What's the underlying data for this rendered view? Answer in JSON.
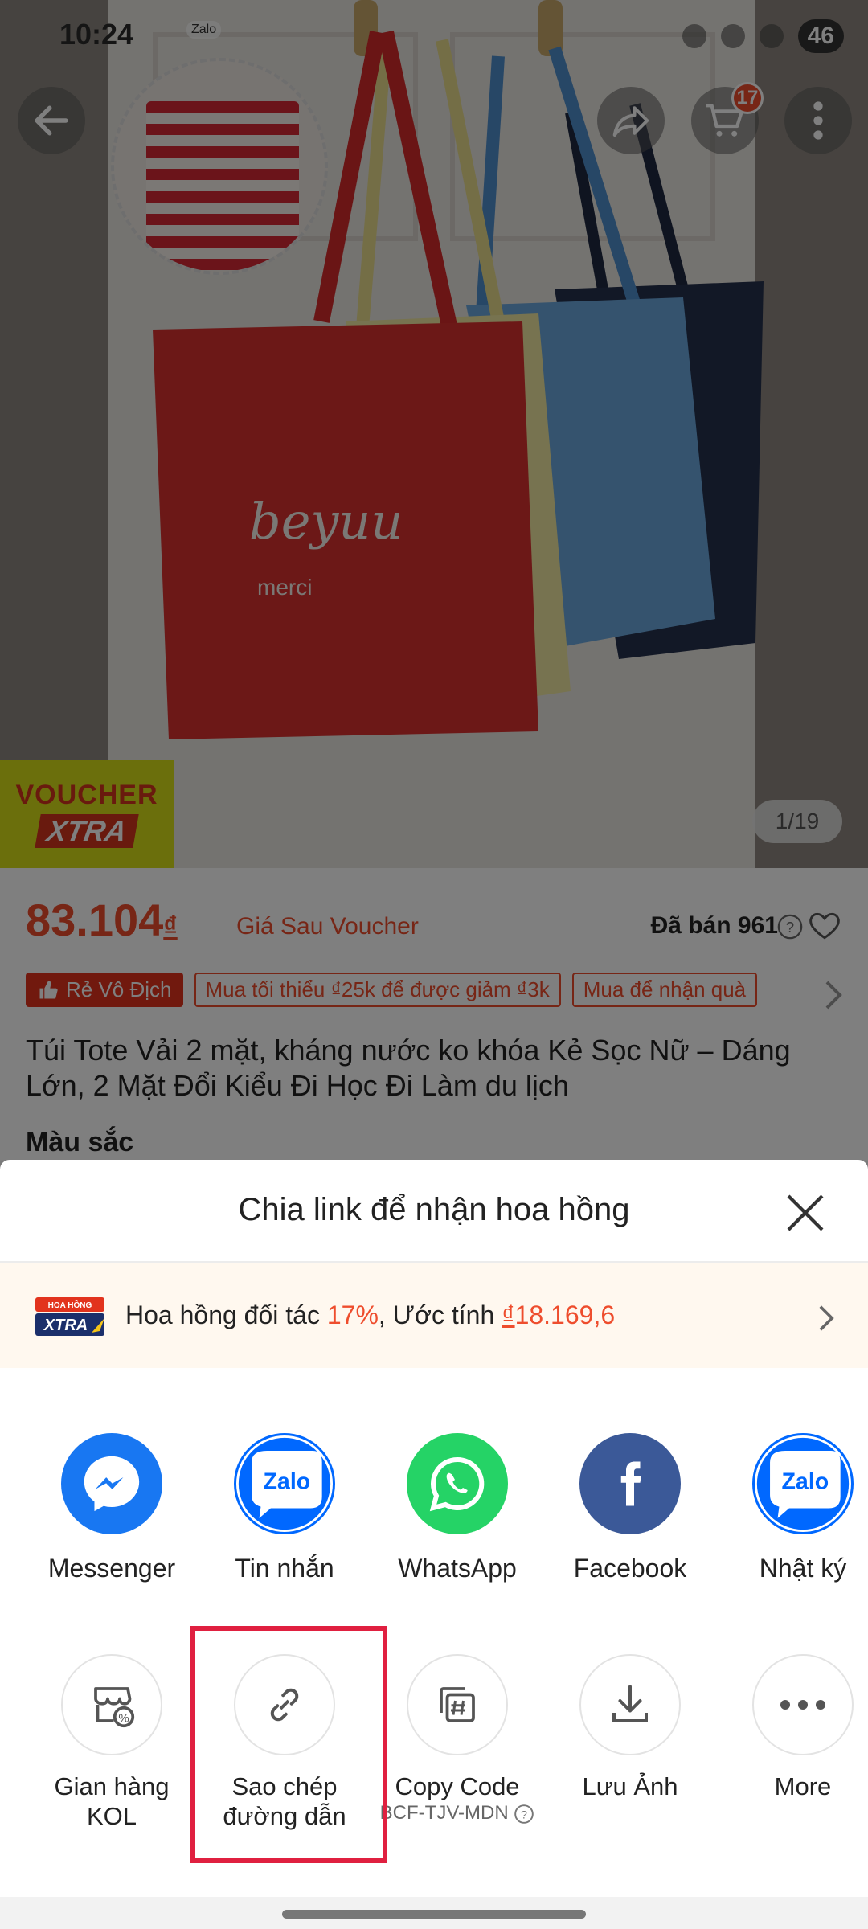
{
  "status_bar": {
    "time": "10:24",
    "app_badge": "Zalo",
    "battery": "46"
  },
  "product_header": {
    "cart_count": "17",
    "image_counter": "1/19",
    "voucher_line1": "VOUCHER",
    "voucher_line2": "XTRA"
  },
  "product": {
    "price": "83.104",
    "price_currency": "₫",
    "price_note": "Giá Sau Voucher",
    "sold": "Đã bán 961",
    "tags": [
      "Rẻ Vô Địch",
      "Mua tối thiểu ₫25k để được giảm ₫3k",
      "Mua để nhận quà"
    ],
    "title": "Túi Tote Vải 2 mặt, kháng nước ko khóa Kẻ Sọc Nữ – Dáng Lớn, 2 Mặt Đổi Kiểu Đi Học Đi Làm du lịch",
    "variant_label": "Màu sắc"
  },
  "share_sheet": {
    "title": "Chia link để nhận hoa hồng",
    "commission": {
      "logo_top": "HOA HỒNG",
      "logo_bottom": "XTRA",
      "prefix": "Hoa hồng đối tác ",
      "rate": "17%",
      "middle": ", Ước tính ",
      "estimate_currency": "₫",
      "estimate_value": "18.169,6"
    },
    "share_targets": [
      {
        "label": "Messenger",
        "icon": "messenger-icon",
        "color": "#1877f2"
      },
      {
        "label": "Tin nhắn",
        "icon": "zalo-icon",
        "color": "#0068ff"
      },
      {
        "label": "WhatsApp",
        "icon": "whatsapp-icon",
        "color": "#25d366"
      },
      {
        "label": "Facebook",
        "icon": "facebook-icon",
        "color": "#3b5998"
      },
      {
        "label": "Nhật ký",
        "icon": "zalo-icon",
        "color": "#0068ff"
      }
    ],
    "zalo_text": "Zalo",
    "tools": [
      {
        "label_line1": "Gian hàng",
        "label_line2": "KOL",
        "icon": "kol-shop-icon"
      },
      {
        "label_line1": "Sao chép",
        "label_line2": "đường dẫn",
        "icon": "link-icon"
      },
      {
        "label_line1": "Copy Code",
        "sub": "BCF-TJV-MDN",
        "icon": "hash-copy-icon"
      },
      {
        "label_line1": "Lưu Ảnh",
        "icon": "download-icon"
      },
      {
        "label_line1": "More",
        "icon": "more-icon"
      }
    ]
  },
  "colors": {
    "accent": "#ee4d2d",
    "highlight_box": "#e02040"
  }
}
